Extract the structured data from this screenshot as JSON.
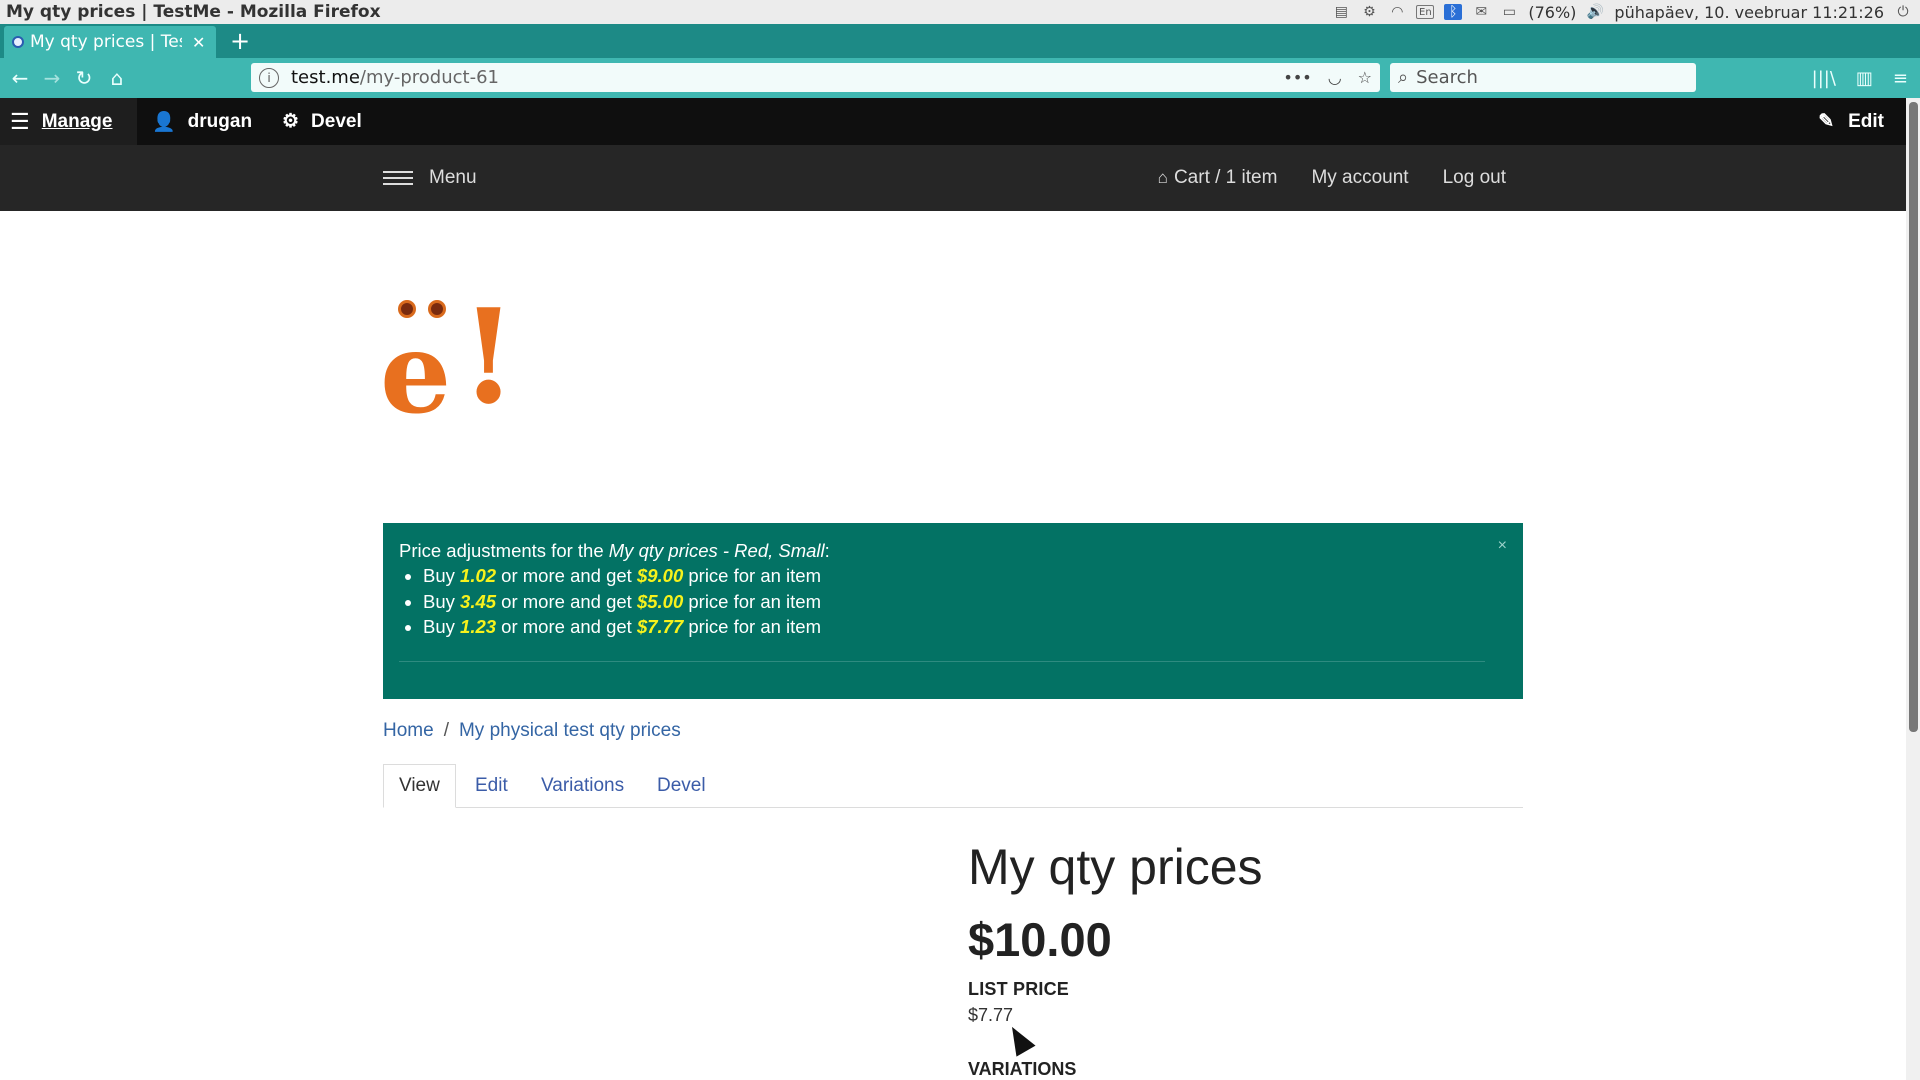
{
  "os": {
    "window_title": "My qty prices | TestMe - Mozilla Firefox",
    "battery": "(76%)",
    "datetime": "pühapäev, 10. veebruar 11:21:26",
    "keyboard": "En"
  },
  "browser": {
    "tab_title": "My qty prices | TestMe",
    "url_host": "test.me",
    "url_path": "/my-product-61",
    "search_placeholder": "Search"
  },
  "toolbar": {
    "manage": "Manage",
    "user": "drugan",
    "devel": "Devel",
    "edit": "Edit"
  },
  "header": {
    "menu": "Menu",
    "cart": "Cart / 1 item",
    "account": "My account",
    "logout": "Log out"
  },
  "logo": {
    "text": "ë!"
  },
  "message": {
    "intro_prefix": "Price adjustments for the ",
    "intro_product": "My qty prices - Red, Small",
    "intro_suffix": ":",
    "items": [
      {
        "pre": "Buy ",
        "qty": "1.02",
        "mid": " or more and get ",
        "price": "$9.00",
        "post": " price for an item"
      },
      {
        "pre": "Buy ",
        "qty": "3.45",
        "mid": " or more and get ",
        "price": "$5.00",
        "post": " price for an item"
      },
      {
        "pre": "Buy ",
        "qty": "1.23",
        "mid": " or more and get ",
        "price": "$7.77",
        "post": " price for an item"
      }
    ],
    "close": "×"
  },
  "breadcrumb": {
    "home": "Home",
    "separator": "/",
    "current": "My physical test qty prices"
  },
  "tabs": {
    "view": "View",
    "edit": "Edit",
    "variations": "Variations",
    "devel": "Devel"
  },
  "product": {
    "title": "My qty prices",
    "price": "$10.00",
    "list_price_label": "LIST PRICE",
    "list_price_value": "$7.77",
    "variations_label": "VARIATIONS"
  }
}
